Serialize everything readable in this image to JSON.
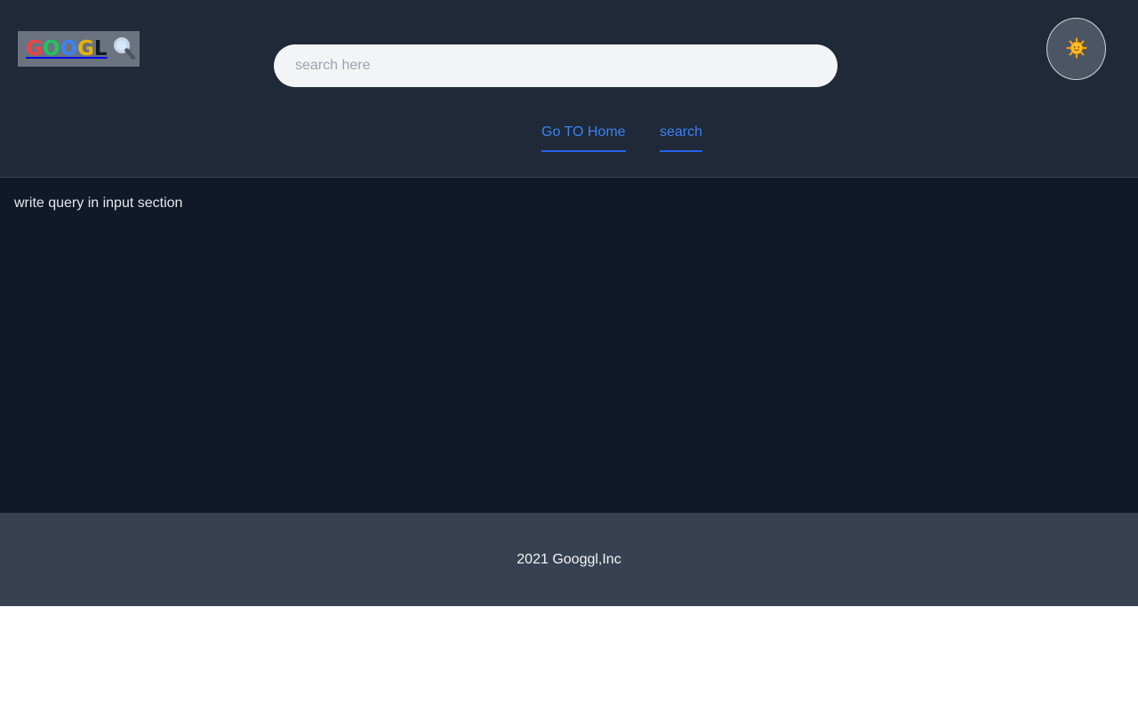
{
  "header": {
    "logo": {
      "letters": [
        {
          "char": "G",
          "color": "#ef4444"
        },
        {
          "char": "O",
          "color": "#22c55e"
        },
        {
          "char": "O",
          "color": "#3b82f6"
        },
        {
          "char": "G",
          "color": "#eab308"
        },
        {
          "char": "L",
          "color": "#111827"
        }
      ],
      "icon": "magnifying-glass-icon"
    },
    "search": {
      "placeholder": "search here",
      "value": ""
    },
    "theme_toggle": {
      "icon": "sun-icon"
    }
  },
  "nav": {
    "home_label": "Go TO Home",
    "search_label": "search"
  },
  "main": {
    "message": "write query in input section"
  },
  "footer": {
    "copyright": "2021 Googgl,Inc"
  },
  "colors": {
    "header_bg": "#1f2937",
    "main_bg": "#111827",
    "footer_bg": "#374151",
    "link": "#3b82f6",
    "link_underline": "#2563eb",
    "logo_bg": "#6b7280"
  }
}
